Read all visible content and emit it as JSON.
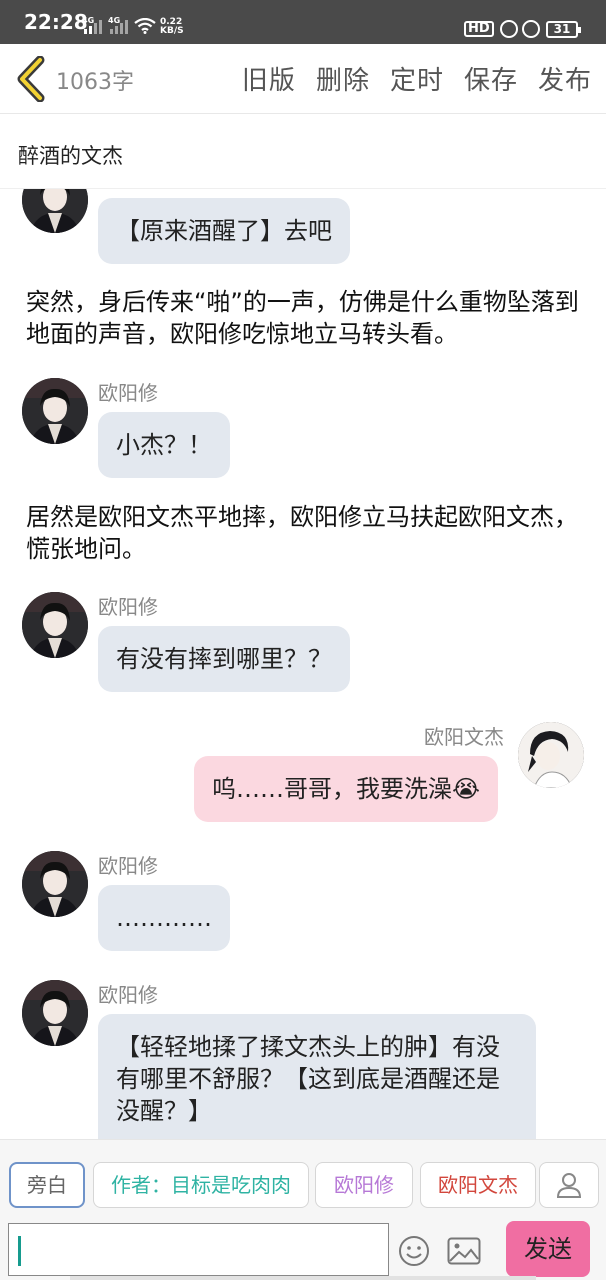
{
  "status_bar": {
    "time": "22:28",
    "sig1": "4G",
    "sig2": "4G",
    "speed_value": "0.22",
    "speed_unit": "KB/S",
    "hd": "HD",
    "battery": "31"
  },
  "header": {
    "word_count": "1063字",
    "actions": [
      "旧版",
      "删除",
      "定时",
      "保存",
      "发布"
    ]
  },
  "title": "醉酒的文杰",
  "characters": {
    "ouyangxiu": "欧阳修",
    "ouyangwenjie": "欧阳文杰"
  },
  "messages": {
    "m0": "【原来酒醒了】去吧",
    "n1": "突然，身后传来“啪”的一声，仿佛是什么重物坠落到地面的声音，欧阳修吃惊地立马转头看。",
    "m1": "小杰？！",
    "n2": "居然是欧阳文杰平地摔，欧阳修立马扶起欧阳文杰，慌张地问。",
    "m2": "有没有摔到哪里？？",
    "m3": "呜……哥哥，我要洗澡😭",
    "m4": "…………",
    "m5": "【轻轻地揉了揉文杰头上的肿】有没有哪里不舒服？【这到底是酒醒还是没醒？】"
  },
  "roles": {
    "narration": "旁白",
    "author": "作者：目标是吃肉肉",
    "ouyangxiu": "欧阳修",
    "ouyangwenjie": "欧阳文杰"
  },
  "input": {
    "value": "",
    "send_label": "发送"
  },
  "colors": {
    "send_button": "#f06ea2",
    "left_bubble": "#e3e8ef",
    "right_bubble": "#fbd8e0",
    "role_author": "#2fb3a3",
    "role_ouyangxiu": "#b678d6",
    "role_ouyangwenjie": "#d2463c"
  },
  "icons": [
    "back-icon",
    "person-icon",
    "emoji-icon",
    "image-icon",
    "wifi-icon",
    "lock-icon",
    "alarm-icon",
    "battery-icon"
  ]
}
